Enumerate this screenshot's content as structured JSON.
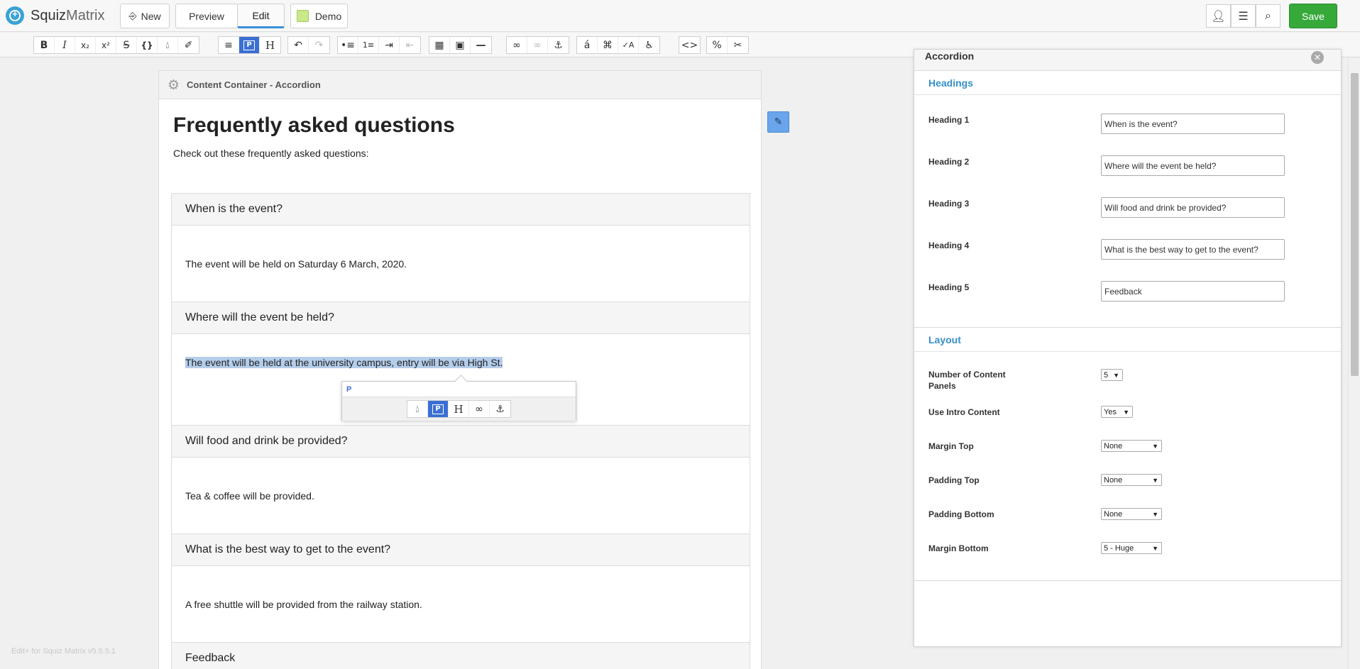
{
  "app": {
    "brand_bold": "Squiz",
    "brand_light": "Matrix"
  },
  "header": {
    "new_label": "New",
    "preview_label": "Preview",
    "edit_label": "Edit",
    "demo_label": "Demo",
    "save_label": "Save"
  },
  "toolbar_icons": [
    "bold-icon",
    "italic-icon",
    "subscript-icon",
    "superscript-icon",
    "strikethrough-icon",
    "curly-braces-icon",
    "color-drop-icon",
    "clear-format-icon",
    "align-left-icon",
    "paragraph-icon",
    "heading-icon",
    "undo-icon",
    "redo-icon",
    "bullet-list-icon",
    "numbered-list-icon",
    "indent-icon",
    "outdent-icon",
    "table-icon",
    "image-icon",
    "horizontal-rule-icon",
    "link-icon",
    "unlink-icon",
    "anchor-icon",
    "special-char-icon",
    "find-replace-icon",
    "spell-check-icon",
    "accessibility-icon",
    "source-code-icon",
    "percent-icon",
    "cut-icon"
  ],
  "container": {
    "title": "Content Container - Accordion"
  },
  "faq": {
    "title": "Frequently asked questions",
    "intro": "Check out these frequently asked questions:",
    "items": [
      {
        "q": "When is the event?",
        "a": "The event will be held on Saturday 6 March, 2020."
      },
      {
        "q": "Where will the event be held?",
        "a": "The event will be held at the university campus, entry will be via High St."
      },
      {
        "q": "Will food and drink be provided?",
        "a": "Tea & coffee will be provided."
      },
      {
        "q": "What is the best way to get to the event?",
        "a": "A free shuttle will be provided from the railway station."
      },
      {
        "q": "Feedback"
      }
    ]
  },
  "popup": {
    "tag": "P"
  },
  "version": "Edit+ for Squiz Matrix v5.5.5.1",
  "panel": {
    "title": "Accordion",
    "headings_section": "Headings",
    "headings": [
      {
        "label": "Heading 1",
        "value": "When is the event?"
      },
      {
        "label": "Heading 2",
        "value": "Where will the event be held?"
      },
      {
        "label": "Heading 3",
        "value": "Will food and drink be provided?"
      },
      {
        "label": "Heading 4",
        "value": "What is the best way to get to the event?"
      },
      {
        "label": "Heading 5",
        "value": "Feedback"
      }
    ],
    "layout_section": "Layout",
    "layout": {
      "num_panels_label": "Number of Content Panels",
      "num_panels_value": "5",
      "intro_label": "Use Intro Content",
      "intro_value": "Yes",
      "margin_top_label": "Margin Top",
      "margin_top_value": "None",
      "padding_top_label": "Padding Top",
      "padding_top_value": "None",
      "padding_bottom_label": "Padding Bottom",
      "padding_bottom_value": "None",
      "margin_bottom_label": "Margin Bottom",
      "margin_bottom_value": "5 - Huge"
    }
  }
}
